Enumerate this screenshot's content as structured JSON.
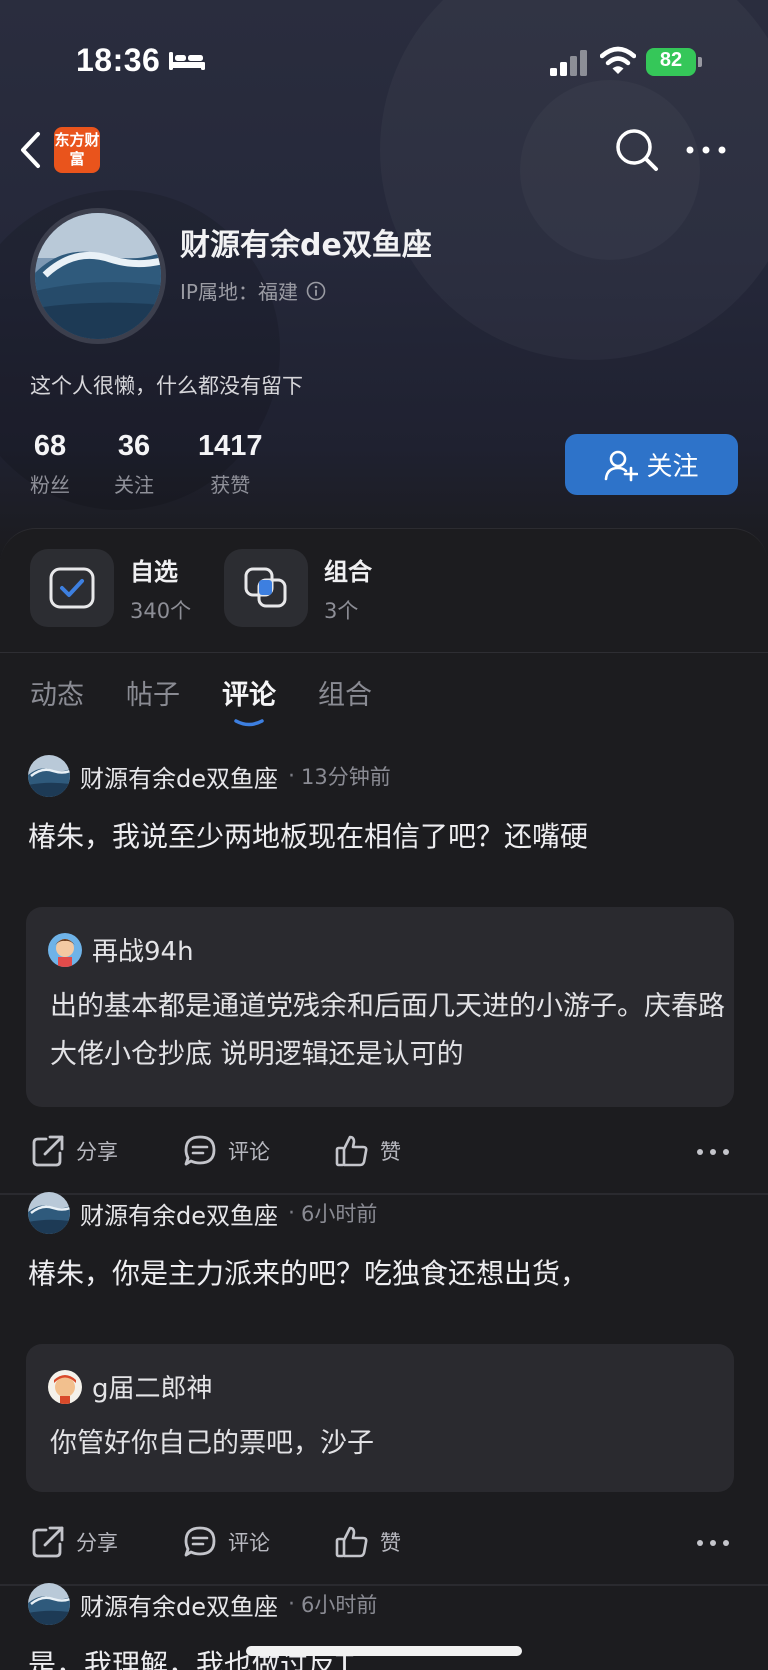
{
  "status_bar": {
    "time": "18:36",
    "battery": "82"
  },
  "nav": {
    "logo_text": "东方财富"
  },
  "profile": {
    "name": "财源有余de双鱼座",
    "ip_location": "IP属地：福建",
    "bio": "这个人很懒，什么都没有留下",
    "stats": [
      {
        "value": "68",
        "label": "粉丝"
      },
      {
        "value": "36",
        "label": "关注"
      },
      {
        "value": "1417",
        "label": "获赞"
      }
    ],
    "follow_label": "关注"
  },
  "shortcuts": [
    {
      "title": "自选",
      "sub": "340个"
    },
    {
      "title": "组合",
      "sub": "3个"
    }
  ],
  "tabs": [
    "动态",
    "帖子",
    "评论",
    "组合"
  ],
  "active_tab": "评论",
  "actions": {
    "share": "分享",
    "comment": "评论",
    "like": "赞"
  },
  "posts": [
    {
      "author": "财源有余de双鱼座",
      "time": "13分钟前",
      "text": "椿朱，我说至少两地板现在相信了吧？还嘴硬",
      "quote": {
        "author": "再战94h",
        "text": "出的基本都是通道党残余和后面几天进的小游子。庆春路大佬小仓抄底 说明逻辑还是认可的"
      }
    },
    {
      "author": "财源有余de双鱼座",
      "time": "6小时前",
      "text": "椿朱，你是主力派来的吧？吃独食还想出货，",
      "quote": {
        "author": "g届二郎神",
        "text": "你管好你自己的票吧，沙子"
      }
    },
    {
      "author": "财源有余de双鱼座",
      "time": "6小时前",
      "text": "是，我理解，我也做过反T"
    }
  ],
  "colors": {
    "accent": "#2e73c9",
    "logo": "#e9541c",
    "battery": "#35c759",
    "background": "#1c1c1f"
  }
}
